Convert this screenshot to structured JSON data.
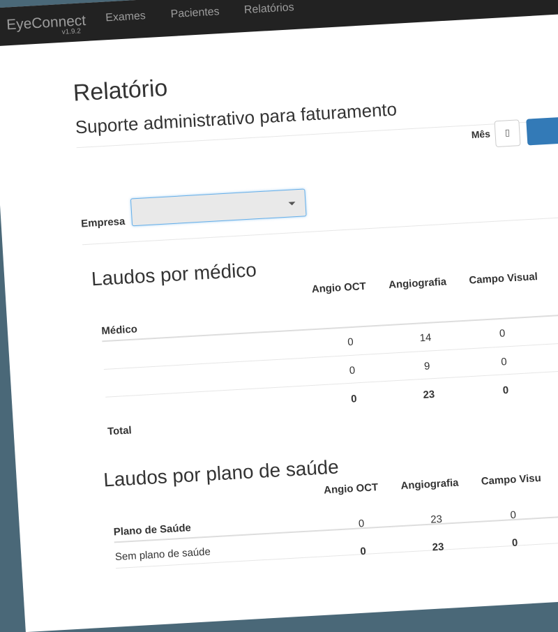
{
  "navbar": {
    "brand": "EyeConnect",
    "version": "v1.9.2",
    "links": [
      "Exames",
      "Pacientes",
      "Relatórios"
    ]
  },
  "page": {
    "title": "Relatório",
    "subtitle": "Suporte administrativo para faturamento"
  },
  "filters": {
    "mes_label": "Mês",
    "empresa_label": "Empresa",
    "empresa_value": ""
  },
  "laudos_medico": {
    "title": "Laudos por médico",
    "columns": [
      "Médico",
      "Angio OCT",
      "Angiografia",
      "Campo Visual"
    ],
    "rows": [
      [
        "",
        "0",
        "14",
        "0"
      ],
      [
        "",
        "0",
        "9",
        "0"
      ]
    ],
    "total": [
      "Total",
      "0",
      "23",
      "0"
    ]
  },
  "laudos_plano": {
    "title": "Laudos por plano de saúde",
    "columns": [
      "Plano de Saúde",
      "Angio OCT",
      "Angiografia",
      "Campo Visu"
    ],
    "rows": [
      [
        "Sem plano de saúde",
        "0",
        "23",
        "0"
      ]
    ],
    "total": [
      "",
      "0",
      "23",
      "0"
    ]
  },
  "colors": {
    "navbar_bg": "#222222",
    "navbar_text": "#9d9d9d",
    "primary_button": "#337ab7",
    "select_focus_border": "#66afe9"
  },
  "icons": {
    "calendar": "calendar-icon",
    "dropdown": "caret-down-icon"
  }
}
